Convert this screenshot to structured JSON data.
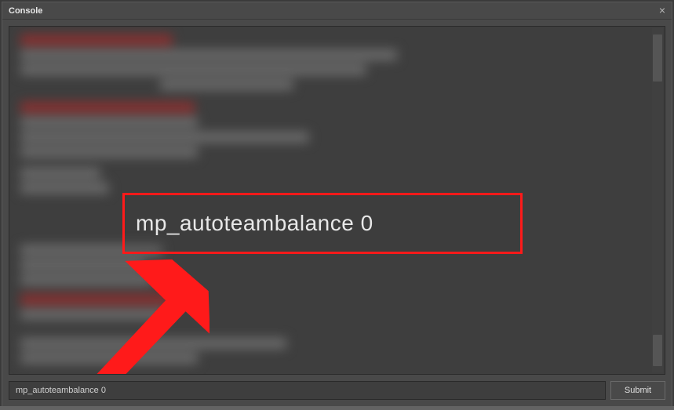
{
  "window": {
    "title": "Console"
  },
  "highlight": {
    "command": "mp_autoteambalance 0"
  },
  "input": {
    "value": "mp_autoteambalance 0"
  },
  "buttons": {
    "submit": "Submit"
  }
}
